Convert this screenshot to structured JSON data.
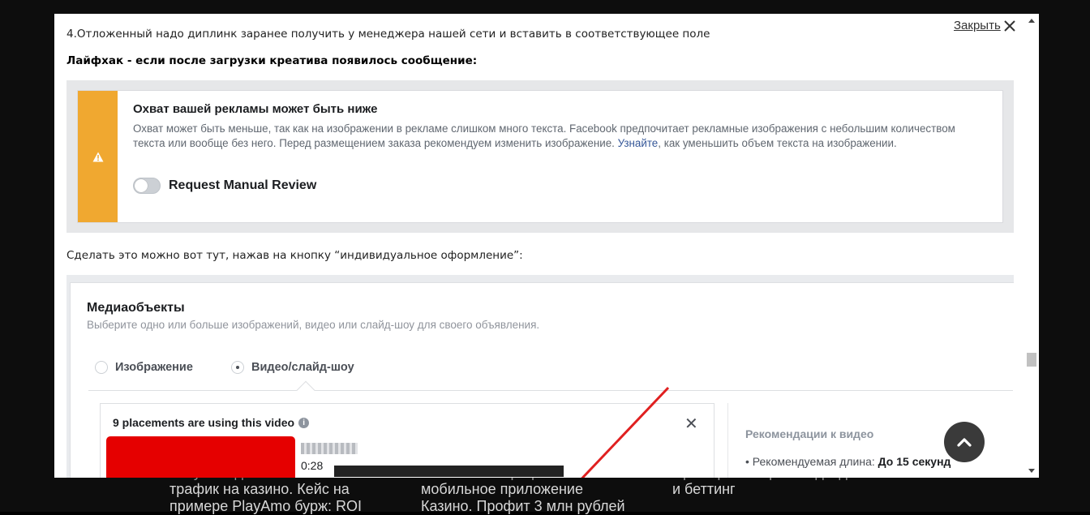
{
  "background_cards": [
    {
      "lines": [
        "получать дешевый и не",
        "трафик на казино. Кейс на",
        "примере PlayAmo бурж: ROI"
      ]
    },
    {
      "lines": [
        "как сливать трафик на",
        "мобильное приложение",
        "Казино. Профит 3 млн рублей"
      ]
    },
    {
      "lines": [
        "Примеры которые подходят",
        "и беттинг"
      ]
    }
  ],
  "modal": {
    "close_label": "Закрыть",
    "paragraph_step4": "4.Отложенный надо диплинк заранее получить у менеджера нашей сети и вставить в соответствующее поле",
    "paragraph_lifehack": "Лайфхак - если после загрузки креатива появилось сообщение:",
    "paragraph_where": "Сделать это можно вот тут, нажав на кнопку “индивидуальное оформление”:"
  },
  "warning_screenshot": {
    "title": "Охват вашей рекламы может быть ниже",
    "body_before_link": "Охват может быть меньше, так как на изображении в рекламе слишком много текста. Facebook предпочитает рекламные изображения с небольшим количеством текста или вообще без него. Перед размещением заказа рекомендуем изменить изображение. ",
    "link_text": "Узнайте",
    "body_after_link": ", как уменьшить объем текста на изображении.",
    "toggle_label": "Request Manual Review",
    "toggle_on": false,
    "accent_color": "#f0a830"
  },
  "media_screenshot": {
    "title": "Медиаобъекты",
    "subtitle": "Выберите одно или больше изображений, видео или слайд-шоу для своего объявления.",
    "radio_image": "Изображение",
    "radio_video": "Видео/слайд-шоу",
    "selected": "Видео/слайд-шоу",
    "placements_text": "9 placements are using this video",
    "info_icon": "i",
    "close_symbol": "✕",
    "duration": "0:28",
    "recommendations_title": "Рекомендации к видео",
    "rec_item_label": "Рекомендуемая длина: ",
    "rec_item_value": "До 15 секунд"
  }
}
